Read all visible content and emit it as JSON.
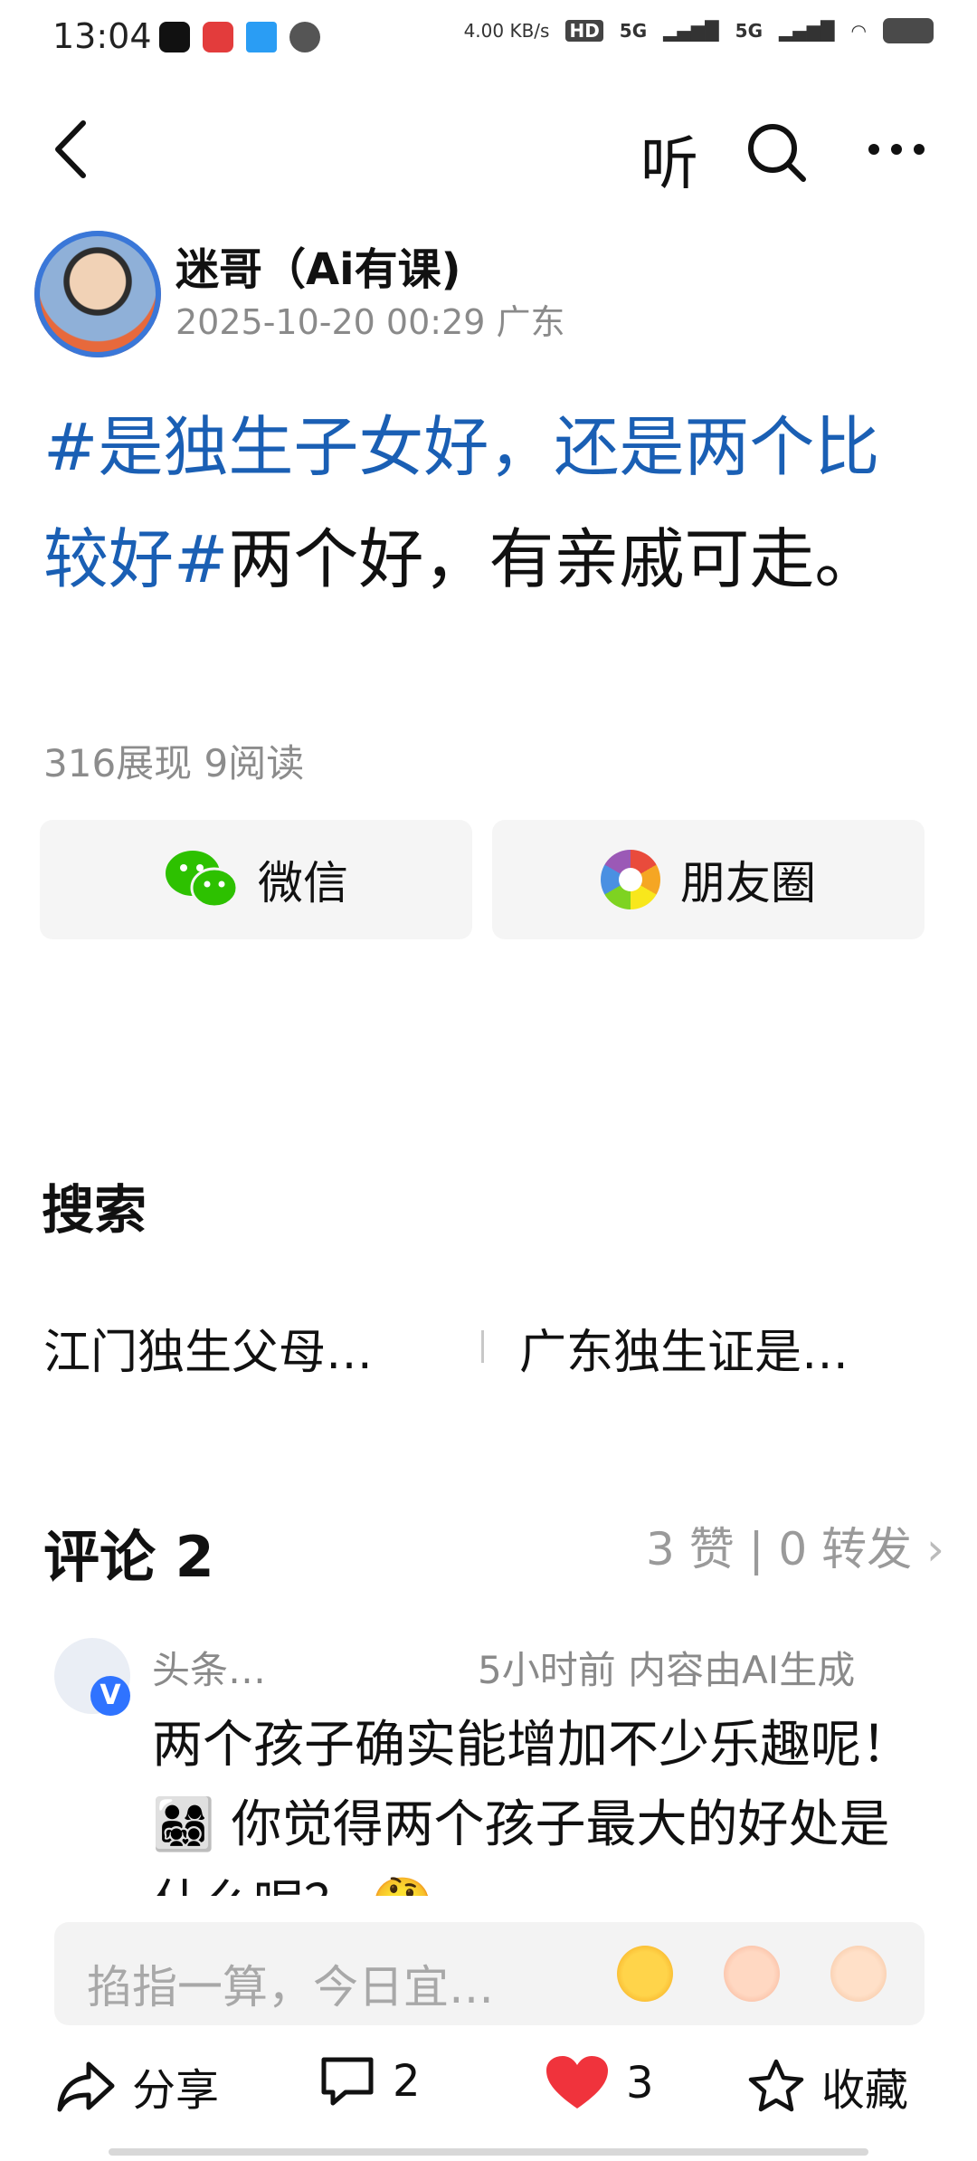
{
  "status_bar": {
    "time": "13:04",
    "net_speed": "4.00 KB/s",
    "net1": "5G",
    "net2": "5G"
  },
  "nav": {
    "listen_label": "听"
  },
  "author": {
    "name": "迷哥（Ai有课)",
    "date_location": "2025-10-20 00:29 广东"
  },
  "post": {
    "hashtag": "#是独生子女好，还是两个比较好#",
    "body": "两个好，有亲戚可走。",
    "stats": "316展现  9阅读"
  },
  "share": {
    "wechat_label": "微信",
    "moments_label": "朋友圈"
  },
  "search": {
    "title": "搜索",
    "suggestions": [
      "江门独生父母…",
      "广东独生证是…"
    ]
  },
  "comments": {
    "title": "评论 2",
    "meta": "3 赞 | 0 转发",
    "items": [
      {
        "user": "头条…",
        "meta": "5小时前  内容由AI生成",
        "text": "两个孩子确实能增加不少乐趣呢！👨‍👩‍👧‍👦 你觉得两个孩子最大的好处是什么呢？ 🤔"
      }
    ]
  },
  "input": {
    "placeholder": "掐指一算，今日宜…"
  },
  "bottom_bar": {
    "share_label": "分享",
    "comment_count": "2",
    "like_count": "3",
    "favorite_label": "收藏"
  },
  "colors": {
    "hashtag": "#1a5fb4",
    "like": "#f0333c",
    "wechat": "#2dc100"
  }
}
